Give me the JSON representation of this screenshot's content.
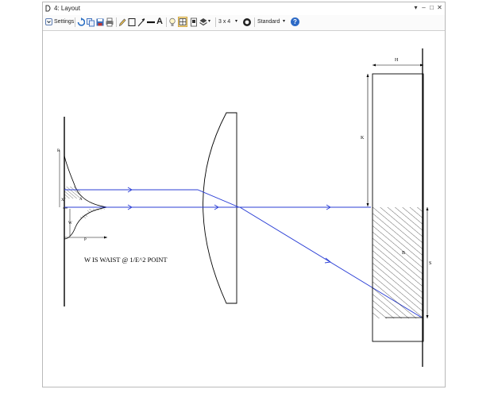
{
  "window": {
    "title": "4: Layout",
    "controls": {
      "dropdown": "▾",
      "minimize": "–",
      "maximize": "□",
      "close": "✕"
    }
  },
  "toolbar": {
    "settings_label": "Settings",
    "layout_label": "3 x 4",
    "layout_arrow": "▾",
    "standard_label": "Standard",
    "standard_arrow": "▾",
    "text_tool_label": "A",
    "help_label": "?"
  },
  "drawing": {
    "annotation": "W IS WAIST @ 1/E^2 POINT",
    "labels": {
      "h": "H",
      "k": "K",
      "b": "B",
      "s": "S",
      "a": "A",
      "w": "W",
      "p": "P",
      "r": "R",
      "x": "X"
    },
    "colors": {
      "ray": "#2b3fd6",
      "line": "#000000"
    }
  }
}
